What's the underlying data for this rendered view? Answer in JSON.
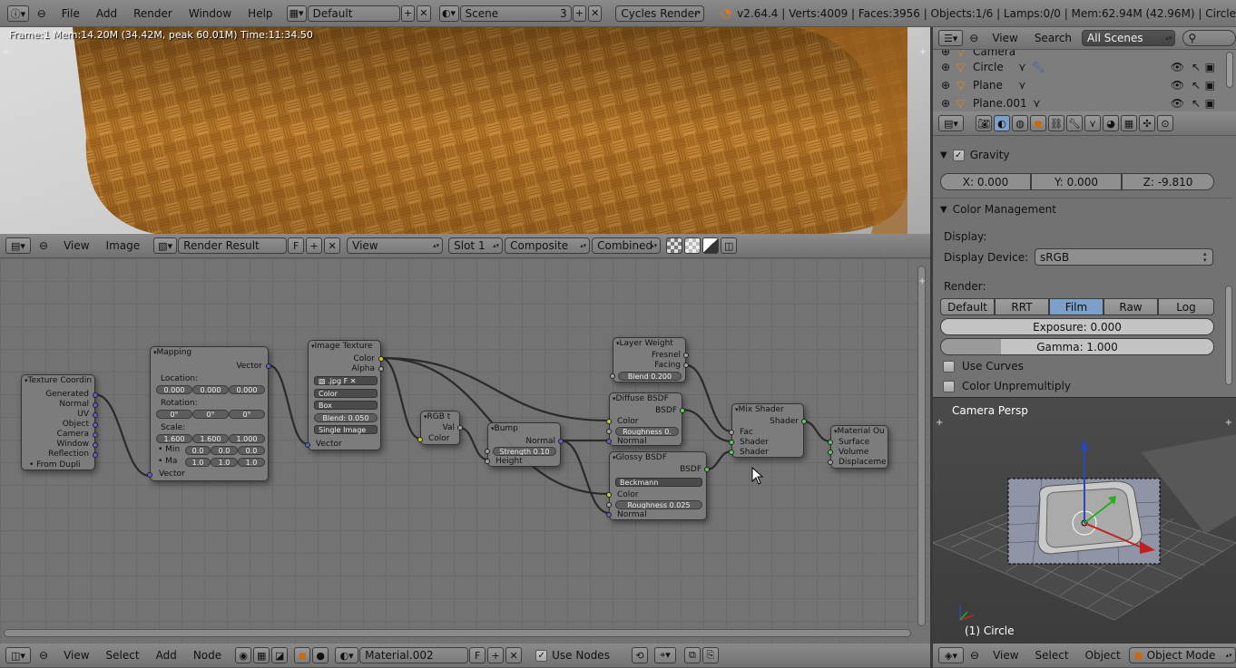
{
  "info_header": {
    "menus": [
      "File",
      "Add",
      "Render",
      "Window",
      "Help"
    ],
    "screen_layout": "Default",
    "scene": "Scene",
    "scene_count": "3",
    "render_engine": "Cycles Render",
    "stats": "v2.64.4 | Verts:4009 | Faces:3956 | Objects:1/6 | Lamps:0/0 | Mem:62.94M (42.96M) | Circle"
  },
  "render_view": {
    "overlay_text": "Frame:1 Mem:14.20M (34.42M, peak 60.01M) Time:11:34.50"
  },
  "image_header": {
    "menus": [
      "View",
      "Image"
    ],
    "image_name": "Render Result",
    "fake_user": "F",
    "view_mode": "View",
    "slot": "Slot 1",
    "layer": "Composite",
    "pass": "Combined"
  },
  "nodes": {
    "texture_coord": {
      "title": "Texture Coordin",
      "outputs": [
        "Generated",
        "Normal",
        "UV",
        "Object",
        "Camera",
        "Window",
        "Reflection"
      ],
      "from_dupli": "From Dupli"
    },
    "mapping": {
      "title": "Mapping",
      "output": "Vector",
      "location_label": "Location:",
      "location": [
        "0.000",
        "0.000",
        "0.000"
      ],
      "rotation_label": "Rotation:",
      "rotation": [
        "0°",
        "0°",
        "0°"
      ],
      "scale_label": "Scale:",
      "scale": [
        "1.600",
        "1.600",
        "1.000"
      ],
      "min_label": "Min",
      "min": [
        "0.0",
        "0.0",
        "0.0"
      ],
      "max_label": "Ma",
      "max": [
        "1.0",
        "1.0",
        "1.0"
      ],
      "input": "Vector"
    },
    "image_texture": {
      "title": "Image Texture",
      "outputs": [
        "Color",
        "Alpha"
      ],
      "file": ".jpg",
      "fake": "F",
      "color_space": "Color",
      "projection": "Box",
      "blend": "Blend: 0.050",
      "source": "Single Image",
      "input": "Vector"
    },
    "rgb_to_bw": {
      "title": "RGB t",
      "output": "Val",
      "input": "Color"
    },
    "bump": {
      "title": "Bump",
      "output": "Normal",
      "strength": "Strength 0.10",
      "input": "Height"
    },
    "layer_weight": {
      "title": "Layer Weight",
      "outputs": [
        "Fresnel",
        "Facing"
      ],
      "blend": "Blend 0.200"
    },
    "diffuse": {
      "title": "Diffuse BSDF",
      "output": "BSDF",
      "inputs": [
        "Color",
        "Roughness 0.",
        "Normal"
      ]
    },
    "glossy": {
      "title": "Glossy BSDF",
      "output": "BSDF",
      "distribution": "Beckmann",
      "inputs": [
        "Color",
        "Roughness 0.025",
        "Normal"
      ]
    },
    "mix_shader": {
      "title": "Mix Shader",
      "output": "Shader",
      "inputs": [
        "Fac",
        "Shader",
        "Shader"
      ]
    },
    "material_output": {
      "title": "Material Ou",
      "inputs": [
        "Surface",
        "Volume",
        "Displaceme"
      ]
    }
  },
  "node_header": {
    "menus": [
      "View",
      "Select",
      "Add",
      "Node"
    ],
    "material": "Material.002",
    "fake_user": "F",
    "use_nodes_label": "Use Nodes",
    "use_nodes": true
  },
  "outliner": {
    "menus": [
      "View",
      "Search"
    ],
    "filter": "All Scenes",
    "items": [
      "Camera",
      "Circle",
      "Plane",
      "Plane.001"
    ]
  },
  "properties": {
    "gravity": {
      "title": "Gravity",
      "x": "X: 0.000",
      "y": "Y: 0.000",
      "z": "Z: -9.810"
    },
    "color_management": {
      "title": "Color Management",
      "display_label": "Display:",
      "display_device_label": "Display Device:",
      "display_device": "sRGB",
      "render_label": "Render:",
      "tabs": [
        "Default",
        "RRT",
        "Film",
        "Raw",
        "Log"
      ],
      "active_tab": "Film",
      "exposure": "Exposure: 0.000",
      "gamma": "Gamma: 1.000",
      "use_curves": "Use Curves",
      "color_unpremultiply": "Color Unpremultiply"
    }
  },
  "viewport3d": {
    "view_name": "Camera Persp",
    "object_label": "(1) Circle",
    "menus": [
      "View",
      "Select",
      "Object"
    ],
    "mode": "Object Mode"
  },
  "colors": {
    "active_tab": "#7e9fc8",
    "socket_shader": "#63c763",
    "socket_color": "#c8c830",
    "socket_vector": "#6363c7"
  }
}
